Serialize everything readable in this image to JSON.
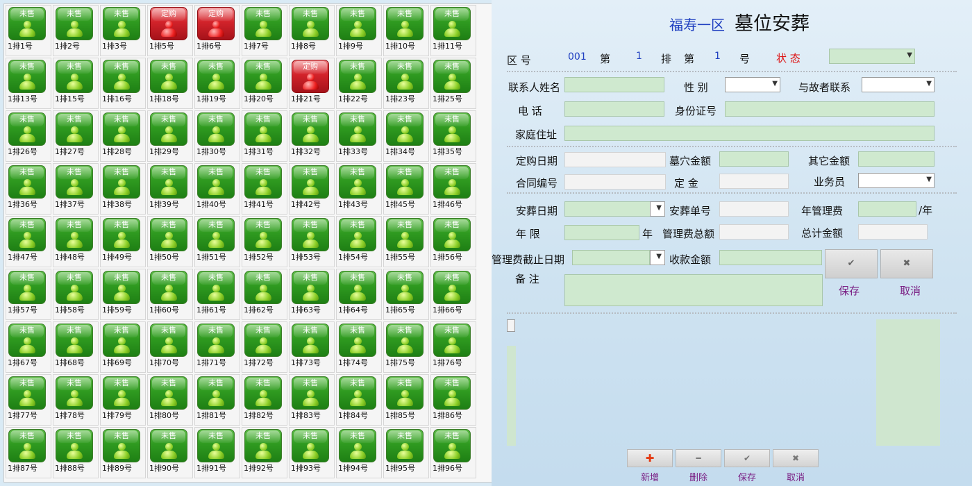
{
  "plots": [
    {
      "label": "1排1号",
      "status": "未售",
      "sold": false
    },
    {
      "label": "1排2号",
      "status": "未售",
      "sold": false
    },
    {
      "label": "1排3号",
      "status": "未售",
      "sold": false
    },
    {
      "label": "1排5号",
      "status": "定购",
      "sold": true
    },
    {
      "label": "1排6号",
      "status": "定购",
      "sold": true
    },
    {
      "label": "1排7号",
      "status": "未售",
      "sold": false
    },
    {
      "label": "1排8号",
      "status": "未售",
      "sold": false
    },
    {
      "label": "1排9号",
      "status": "未售",
      "sold": false
    },
    {
      "label": "1排10号",
      "status": "未售",
      "sold": false
    },
    {
      "label": "1排11号",
      "status": "未售",
      "sold": false
    },
    {
      "label": "1排13号",
      "status": "未售",
      "sold": false
    },
    {
      "label": "1排15号",
      "status": "未售",
      "sold": false
    },
    {
      "label": "1排16号",
      "status": "未售",
      "sold": false
    },
    {
      "label": "1排18号",
      "status": "未售",
      "sold": false
    },
    {
      "label": "1排19号",
      "status": "未售",
      "sold": false
    },
    {
      "label": "1排20号",
      "status": "未售",
      "sold": false
    },
    {
      "label": "1排21号",
      "status": "定购",
      "sold": true
    },
    {
      "label": "1排22号",
      "status": "未售",
      "sold": false
    },
    {
      "label": "1排23号",
      "status": "未售",
      "sold": false
    },
    {
      "label": "1排25号",
      "status": "未售",
      "sold": false
    },
    {
      "label": "1排26号",
      "status": "未售",
      "sold": false
    },
    {
      "label": "1排27号",
      "status": "未售",
      "sold": false
    },
    {
      "label": "1排28号",
      "status": "未售",
      "sold": false
    },
    {
      "label": "1排29号",
      "status": "未售",
      "sold": false
    },
    {
      "label": "1排30号",
      "status": "未售",
      "sold": false
    },
    {
      "label": "1排31号",
      "status": "未售",
      "sold": false
    },
    {
      "label": "1排32号",
      "status": "未售",
      "sold": false
    },
    {
      "label": "1排33号",
      "status": "未售",
      "sold": false
    },
    {
      "label": "1排34号",
      "status": "未售",
      "sold": false
    },
    {
      "label": "1排35号",
      "status": "未售",
      "sold": false
    },
    {
      "label": "1排36号",
      "status": "未售",
      "sold": false
    },
    {
      "label": "1排37号",
      "status": "未售",
      "sold": false
    },
    {
      "label": "1排38号",
      "status": "未售",
      "sold": false
    },
    {
      "label": "1排39号",
      "status": "未售",
      "sold": false
    },
    {
      "label": "1排40号",
      "status": "未售",
      "sold": false
    },
    {
      "label": "1排41号",
      "status": "未售",
      "sold": false
    },
    {
      "label": "1排42号",
      "status": "未售",
      "sold": false
    },
    {
      "label": "1排43号",
      "status": "未售",
      "sold": false
    },
    {
      "label": "1排45号",
      "status": "未售",
      "sold": false
    },
    {
      "label": "1排46号",
      "status": "未售",
      "sold": false
    },
    {
      "label": "1排47号",
      "status": "未售",
      "sold": false
    },
    {
      "label": "1排48号",
      "status": "未售",
      "sold": false
    },
    {
      "label": "1排49号",
      "status": "未售",
      "sold": false
    },
    {
      "label": "1排50号",
      "status": "未售",
      "sold": false
    },
    {
      "label": "1排51号",
      "status": "未售",
      "sold": false
    },
    {
      "label": "1排52号",
      "status": "未售",
      "sold": false
    },
    {
      "label": "1排53号",
      "status": "未售",
      "sold": false
    },
    {
      "label": "1排54号",
      "status": "未售",
      "sold": false
    },
    {
      "label": "1排55号",
      "status": "未售",
      "sold": false
    },
    {
      "label": "1排56号",
      "status": "未售",
      "sold": false
    },
    {
      "label": "1排57号",
      "status": "未售",
      "sold": false
    },
    {
      "label": "1排58号",
      "status": "未售",
      "sold": false
    },
    {
      "label": "1排59号",
      "status": "未售",
      "sold": false
    },
    {
      "label": "1排60号",
      "status": "未售",
      "sold": false
    },
    {
      "label": "1排61号",
      "status": "未售",
      "sold": false
    },
    {
      "label": "1排62号",
      "status": "未售",
      "sold": false
    },
    {
      "label": "1排63号",
      "status": "未售",
      "sold": false
    },
    {
      "label": "1排64号",
      "status": "未售",
      "sold": false
    },
    {
      "label": "1排65号",
      "status": "未售",
      "sold": false
    },
    {
      "label": "1排66号",
      "status": "未售",
      "sold": false
    },
    {
      "label": "1排67号",
      "status": "未售",
      "sold": false
    },
    {
      "label": "1排68号",
      "status": "未售",
      "sold": false
    },
    {
      "label": "1排69号",
      "status": "未售",
      "sold": false
    },
    {
      "label": "1排70号",
      "status": "未售",
      "sold": false
    },
    {
      "label": "1排71号",
      "status": "未售",
      "sold": false
    },
    {
      "label": "1排72号",
      "status": "未售",
      "sold": false
    },
    {
      "label": "1排73号",
      "status": "未售",
      "sold": false
    },
    {
      "label": "1排74号",
      "status": "未售",
      "sold": false
    },
    {
      "label": "1排75号",
      "status": "未售",
      "sold": false
    },
    {
      "label": "1排76号",
      "status": "未售",
      "sold": false
    },
    {
      "label": "1排77号",
      "status": "未售",
      "sold": false
    },
    {
      "label": "1排78号",
      "status": "未售",
      "sold": false
    },
    {
      "label": "1排79号",
      "status": "未售",
      "sold": false
    },
    {
      "label": "1排80号",
      "status": "未售",
      "sold": false
    },
    {
      "label": "1排81号",
      "status": "未售",
      "sold": false
    },
    {
      "label": "1排82号",
      "status": "未售",
      "sold": false
    },
    {
      "label": "1排83号",
      "status": "未售",
      "sold": false
    },
    {
      "label": "1排84号",
      "status": "未售",
      "sold": false
    },
    {
      "label": "1排85号",
      "status": "未售",
      "sold": false
    },
    {
      "label": "1排86号",
      "status": "未售",
      "sold": false
    },
    {
      "label": "1排87号",
      "status": "未售",
      "sold": false
    },
    {
      "label": "1排88号",
      "status": "未售",
      "sold": false
    },
    {
      "label": "1排89号",
      "status": "未售",
      "sold": false
    },
    {
      "label": "1排90号",
      "status": "未售",
      "sold": false
    },
    {
      "label": "1排91号",
      "status": "未售",
      "sold": false
    },
    {
      "label": "1排92号",
      "status": "未售",
      "sold": false
    },
    {
      "label": "1排93号",
      "status": "未售",
      "sold": false
    },
    {
      "label": "1排94号",
      "status": "未售",
      "sold": false
    },
    {
      "label": "1排95号",
      "status": "未售",
      "sold": false
    },
    {
      "label": "1排96号",
      "status": "未售",
      "sold": false
    }
  ],
  "header": {
    "area": "福寿一区",
    "title": "墓位安葬"
  },
  "position": {
    "zone_label": "区  号",
    "zone_value": "001",
    "row_prefix": "第",
    "row_value": "1",
    "row_suffix": "排",
    "num_prefix": "第",
    "num_value": "1",
    "num_suffix": "号",
    "status_label": "状  态",
    "status_value": ""
  },
  "contact": {
    "name_label": "联系人姓名",
    "name_value": "",
    "gender_label": "性  别",
    "gender_value": "",
    "relation_label": "与故者联系",
    "relation_value": "",
    "phone_label": "电  话",
    "phone_value": "",
    "id_label": "身份证号",
    "id_value": "",
    "address_label": "家庭住址",
    "address_value": ""
  },
  "order": {
    "date_label": "定购日期",
    "date_value": "",
    "plot_amount_label": "墓穴金额",
    "plot_amount_value": "",
    "other_amount_label": "其它金额",
    "other_amount_value": "",
    "contract_label": "合同编号",
    "contract_value": "",
    "deposit_label": "定  金",
    "deposit_value": "",
    "salesman_label": "业务员",
    "salesman_value": ""
  },
  "burial": {
    "date_label": "安葬日期",
    "date_value": "",
    "ticket_label": "安葬单号",
    "ticket_value": "",
    "annual_fee_label": "年管理费",
    "annual_fee_value": "",
    "per_year": "/年",
    "years_label": "年  限",
    "years_value": "",
    "years_unit": "年",
    "fee_total_label": "管理费总额",
    "fee_total_value": "",
    "grand_total_label": "总计金额",
    "grand_total_value": "",
    "expiry_label": "管理费截止日期",
    "expiry_value": "",
    "received_label": "收款金额",
    "received_value": "",
    "remark_label": "备  注",
    "remark_value": ""
  },
  "form_buttons": {
    "save": "保存",
    "cancel": "取消"
  },
  "toolbar": {
    "add": "新增",
    "delete": "删除",
    "save": "保存",
    "cancel": "取消"
  }
}
